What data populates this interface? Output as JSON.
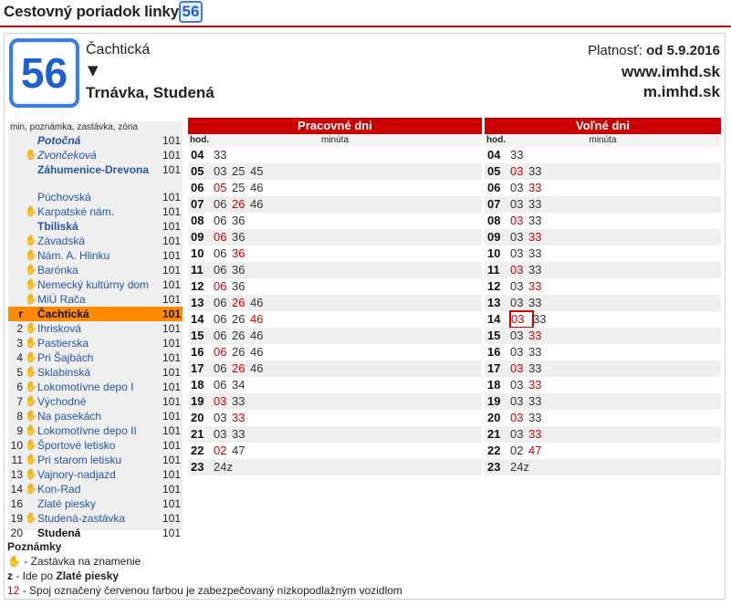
{
  "page": {
    "title": "Cestovný poriadok linky",
    "line_number": "56"
  },
  "header": {
    "line_number": "56",
    "current_stop": "Čachtická",
    "direction_arrow": "▼",
    "destination": "Trnávka, Studená",
    "validity_label": "Platnosť:",
    "validity_value": "od 5.9.2016",
    "site_main": "www.imhd.sk",
    "site_mobile": "m.imhd.sk"
  },
  "stops": {
    "header": "min, poznámka, zastávka, zóna",
    "items": [
      {
        "mins": "",
        "request": false,
        "name": "Potočná",
        "zone": "101",
        "style": "bold-italic"
      },
      {
        "mins": "",
        "request": true,
        "name": "Zvončeková",
        "zone": "101",
        "style": "italic"
      },
      {
        "mins": "",
        "request": false,
        "name": "Záhumenice-Drevona",
        "zone": "101",
        "style": "bold"
      },
      {
        "mins": "",
        "request": false,
        "name": "Púchovská",
        "zone": "101",
        "style": ""
      },
      {
        "mins": "",
        "request": true,
        "name": "Karpatské nám.",
        "zone": "101",
        "style": ""
      },
      {
        "mins": "",
        "request": false,
        "name": "Tbiliská",
        "zone": "101",
        "style": "bold"
      },
      {
        "mins": "",
        "request": true,
        "name": "Závadská",
        "zone": "101",
        "style": ""
      },
      {
        "mins": "",
        "request": true,
        "name": "Nám. A. Hlinku",
        "zone": "101",
        "style": ""
      },
      {
        "mins": "",
        "request": true,
        "name": "Barónka",
        "zone": "101",
        "style": ""
      },
      {
        "mins": "",
        "request": true,
        "name": "Nemecký kultúrny dom",
        "zone": "101",
        "style": ""
      },
      {
        "mins": "",
        "request": true,
        "name": "MiÚ Rača",
        "zone": "101",
        "style": ""
      },
      {
        "mins": "r",
        "request": false,
        "name": "Čachtická",
        "zone": "101",
        "style": "current"
      },
      {
        "mins": "2",
        "request": true,
        "name": "Ihrisková",
        "zone": "101",
        "style": ""
      },
      {
        "mins": "3",
        "request": true,
        "name": "Pastierska",
        "zone": "101",
        "style": ""
      },
      {
        "mins": "4",
        "request": true,
        "name": "Pri Šajbách",
        "zone": "101",
        "style": ""
      },
      {
        "mins": "5",
        "request": true,
        "name": "Sklabinská",
        "zone": "101",
        "style": ""
      },
      {
        "mins": "6",
        "request": true,
        "name": "Lokomotívne depo I",
        "zone": "101",
        "style": ""
      },
      {
        "mins": "7",
        "request": true,
        "name": "Východné",
        "zone": "101",
        "style": ""
      },
      {
        "mins": "8",
        "request": true,
        "name": "Na pasekách",
        "zone": "101",
        "style": ""
      },
      {
        "mins": "9",
        "request": true,
        "name": "Lokomotívne depo II",
        "zone": "101",
        "style": ""
      },
      {
        "mins": "10",
        "request": true,
        "name": "Športové letisko",
        "zone": "101",
        "style": ""
      },
      {
        "mins": "11",
        "request": true,
        "name": "Pri starom letisku",
        "zone": "101",
        "style": ""
      },
      {
        "mins": "13",
        "request": true,
        "name": "Vajnory-nadjazd",
        "zone": "101",
        "style": ""
      },
      {
        "mins": "14",
        "request": true,
        "name": "Kon-Rad",
        "zone": "101",
        "style": ""
      },
      {
        "mins": "16",
        "request": false,
        "name": "Zlaté piesky",
        "zone": "101",
        "style": ""
      },
      {
        "mins": "19",
        "request": true,
        "name": "Studená-zastávka",
        "zone": "101",
        "style": ""
      },
      {
        "mins": "20",
        "request": false,
        "name": "Studená",
        "zone": "101",
        "style": "final"
      }
    ]
  },
  "timetable": {
    "hour_label": "hod.",
    "minute_label": "minúta",
    "workdays": {
      "title": "Pracovné dni",
      "rows": [
        {
          "hour": "04",
          "mins": [
            {
              "v": "33",
              "low": false
            }
          ]
        },
        {
          "hour": "05",
          "mins": [
            {
              "v": "03",
              "low": false
            },
            {
              "v": "25",
              "low": false
            },
            {
              "v": "45",
              "low": false
            }
          ]
        },
        {
          "hour": "06",
          "mins": [
            {
              "v": "05",
              "low": true
            },
            {
              "v": "25",
              "low": false
            },
            {
              "v": "46",
              "low": false
            }
          ]
        },
        {
          "hour": "07",
          "mins": [
            {
              "v": "06",
              "low": false
            },
            {
              "v": "26",
              "low": true
            },
            {
              "v": "46",
              "low": false
            }
          ]
        },
        {
          "hour": "08",
          "mins": [
            {
              "v": "06",
              "low": false
            },
            {
              "v": "36",
              "low": false
            }
          ]
        },
        {
          "hour": "09",
          "mins": [
            {
              "v": "06",
              "low": true
            },
            {
              "v": "36",
              "low": false
            }
          ]
        },
        {
          "hour": "10",
          "mins": [
            {
              "v": "06",
              "low": false
            },
            {
              "v": "36",
              "low": true
            }
          ]
        },
        {
          "hour": "11",
          "mins": [
            {
              "v": "06",
              "low": false
            },
            {
              "v": "36",
              "low": false
            }
          ]
        },
        {
          "hour": "12",
          "mins": [
            {
              "v": "06",
              "low": true
            },
            {
              "v": "36",
              "low": false
            }
          ]
        },
        {
          "hour": "13",
          "mins": [
            {
              "v": "06",
              "low": false
            },
            {
              "v": "26",
              "low": true
            },
            {
              "v": "46",
              "low": false
            }
          ]
        },
        {
          "hour": "14",
          "mins": [
            {
              "v": "06",
              "low": false
            },
            {
              "v": "26",
              "low": false
            },
            {
              "v": "46",
              "low": true
            }
          ]
        },
        {
          "hour": "15",
          "mins": [
            {
              "v": "06",
              "low": false
            },
            {
              "v": "26",
              "low": false
            },
            {
              "v": "46",
              "low": false
            }
          ]
        },
        {
          "hour": "16",
          "mins": [
            {
              "v": "06",
              "low": true
            },
            {
              "v": "26",
              "low": false
            },
            {
              "v": "46",
              "low": false
            }
          ]
        },
        {
          "hour": "17",
          "mins": [
            {
              "v": "06",
              "low": false
            },
            {
              "v": "26",
              "low": true
            },
            {
              "v": "46",
              "low": false
            }
          ]
        },
        {
          "hour": "18",
          "mins": [
            {
              "v": "06",
              "low": false
            },
            {
              "v": "34",
              "low": false
            }
          ]
        },
        {
          "hour": "19",
          "mins": [
            {
              "v": "03",
              "low": true
            },
            {
              "v": "33",
              "low": false
            }
          ]
        },
        {
          "hour": "20",
          "mins": [
            {
              "v": "03",
              "low": false
            },
            {
              "v": "33",
              "low": true
            }
          ]
        },
        {
          "hour": "21",
          "mins": [
            {
              "v": "03",
              "low": false
            },
            {
              "v": "33",
              "low": false
            }
          ]
        },
        {
          "hour": "22",
          "mins": [
            {
              "v": "02",
              "low": true
            },
            {
              "v": "47",
              "low": false
            }
          ]
        },
        {
          "hour": "23",
          "mins": [
            {
              "v": "24z",
              "low": false
            }
          ]
        }
      ]
    },
    "weekends": {
      "title": "Voľné dni",
      "rows": [
        {
          "hour": "04",
          "mins": [
            {
              "v": "33",
              "low": false
            }
          ]
        },
        {
          "hour": "05",
          "mins": [
            {
              "v": "03",
              "low": true
            },
            {
              "v": "33",
              "low": false
            }
          ]
        },
        {
          "hour": "06",
          "mins": [
            {
              "v": "03",
              "low": false
            },
            {
              "v": "33",
              "low": true
            }
          ]
        },
        {
          "hour": "07",
          "mins": [
            {
              "v": "03",
              "low": false
            },
            {
              "v": "33",
              "low": false
            }
          ]
        },
        {
          "hour": "08",
          "mins": [
            {
              "v": "03",
              "low": true
            },
            {
              "v": "33",
              "low": false
            }
          ]
        },
        {
          "hour": "09",
          "mins": [
            {
              "v": "03",
              "low": false
            },
            {
              "v": "33",
              "low": true
            }
          ]
        },
        {
          "hour": "10",
          "mins": [
            {
              "v": "03",
              "low": false
            },
            {
              "v": "33",
              "low": false
            }
          ]
        },
        {
          "hour": "11",
          "mins": [
            {
              "v": "03",
              "low": true
            },
            {
              "v": "33",
              "low": false
            }
          ]
        },
        {
          "hour": "12",
          "mins": [
            {
              "v": "03",
              "low": false
            },
            {
              "v": "33",
              "low": true
            }
          ]
        },
        {
          "hour": "13",
          "mins": [
            {
              "v": "03",
              "low": false
            },
            {
              "v": "33",
              "low": false
            }
          ]
        },
        {
          "hour": "14",
          "mins": [
            {
              "v": "03",
              "low": true,
              "boxed": true
            },
            {
              "v": "33",
              "low": false
            }
          ]
        },
        {
          "hour": "15",
          "mins": [
            {
              "v": "03",
              "low": false
            },
            {
              "v": "33",
              "low": true
            }
          ]
        },
        {
          "hour": "16",
          "mins": [
            {
              "v": "03",
              "low": false
            },
            {
              "v": "33",
              "low": false
            }
          ]
        },
        {
          "hour": "17",
          "mins": [
            {
              "v": "03",
              "low": true
            },
            {
              "v": "33",
              "low": false
            }
          ]
        },
        {
          "hour": "18",
          "mins": [
            {
              "v": "03",
              "low": false
            },
            {
              "v": "33",
              "low": true
            }
          ]
        },
        {
          "hour": "19",
          "mins": [
            {
              "v": "03",
              "low": false
            },
            {
              "v": "33",
              "low": false
            }
          ]
        },
        {
          "hour": "20",
          "mins": [
            {
              "v": "03",
              "low": true
            },
            {
              "v": "33",
              "low": false
            }
          ]
        },
        {
          "hour": "21",
          "mins": [
            {
              "v": "03",
              "low": false
            },
            {
              "v": "33",
              "low": true
            }
          ]
        },
        {
          "hour": "22",
          "mins": [
            {
              "v": "02",
              "low": false
            },
            {
              "v": "47",
              "low": true
            }
          ]
        },
        {
          "hour": "23",
          "mins": [
            {
              "v": "24z",
              "low": false
            }
          ]
        }
      ]
    }
  },
  "notes": {
    "title": "Poznámky",
    "request_symbol": "✋",
    "request_text": " - Zastávka na znamenie",
    "z_key": "z",
    "z_text_prefix": " - Ide po ",
    "z_text_bold": "Zlaté piesky",
    "low_example": "12",
    "low_text": " - Spoj označený červenou farbou je zabezpečovaný nízkopodlažným vozidlom"
  },
  "colors": {
    "accent_red": "#cc0000",
    "low_floor_red": "#d40000",
    "line_blue": "#1d5fd1",
    "stop_link_blue": "#2455a6",
    "current_stop_orange": "#ff8a00"
  },
  "icons": {
    "request_stop": "raised-hand-icon",
    "direction": "down-arrow-icon"
  }
}
